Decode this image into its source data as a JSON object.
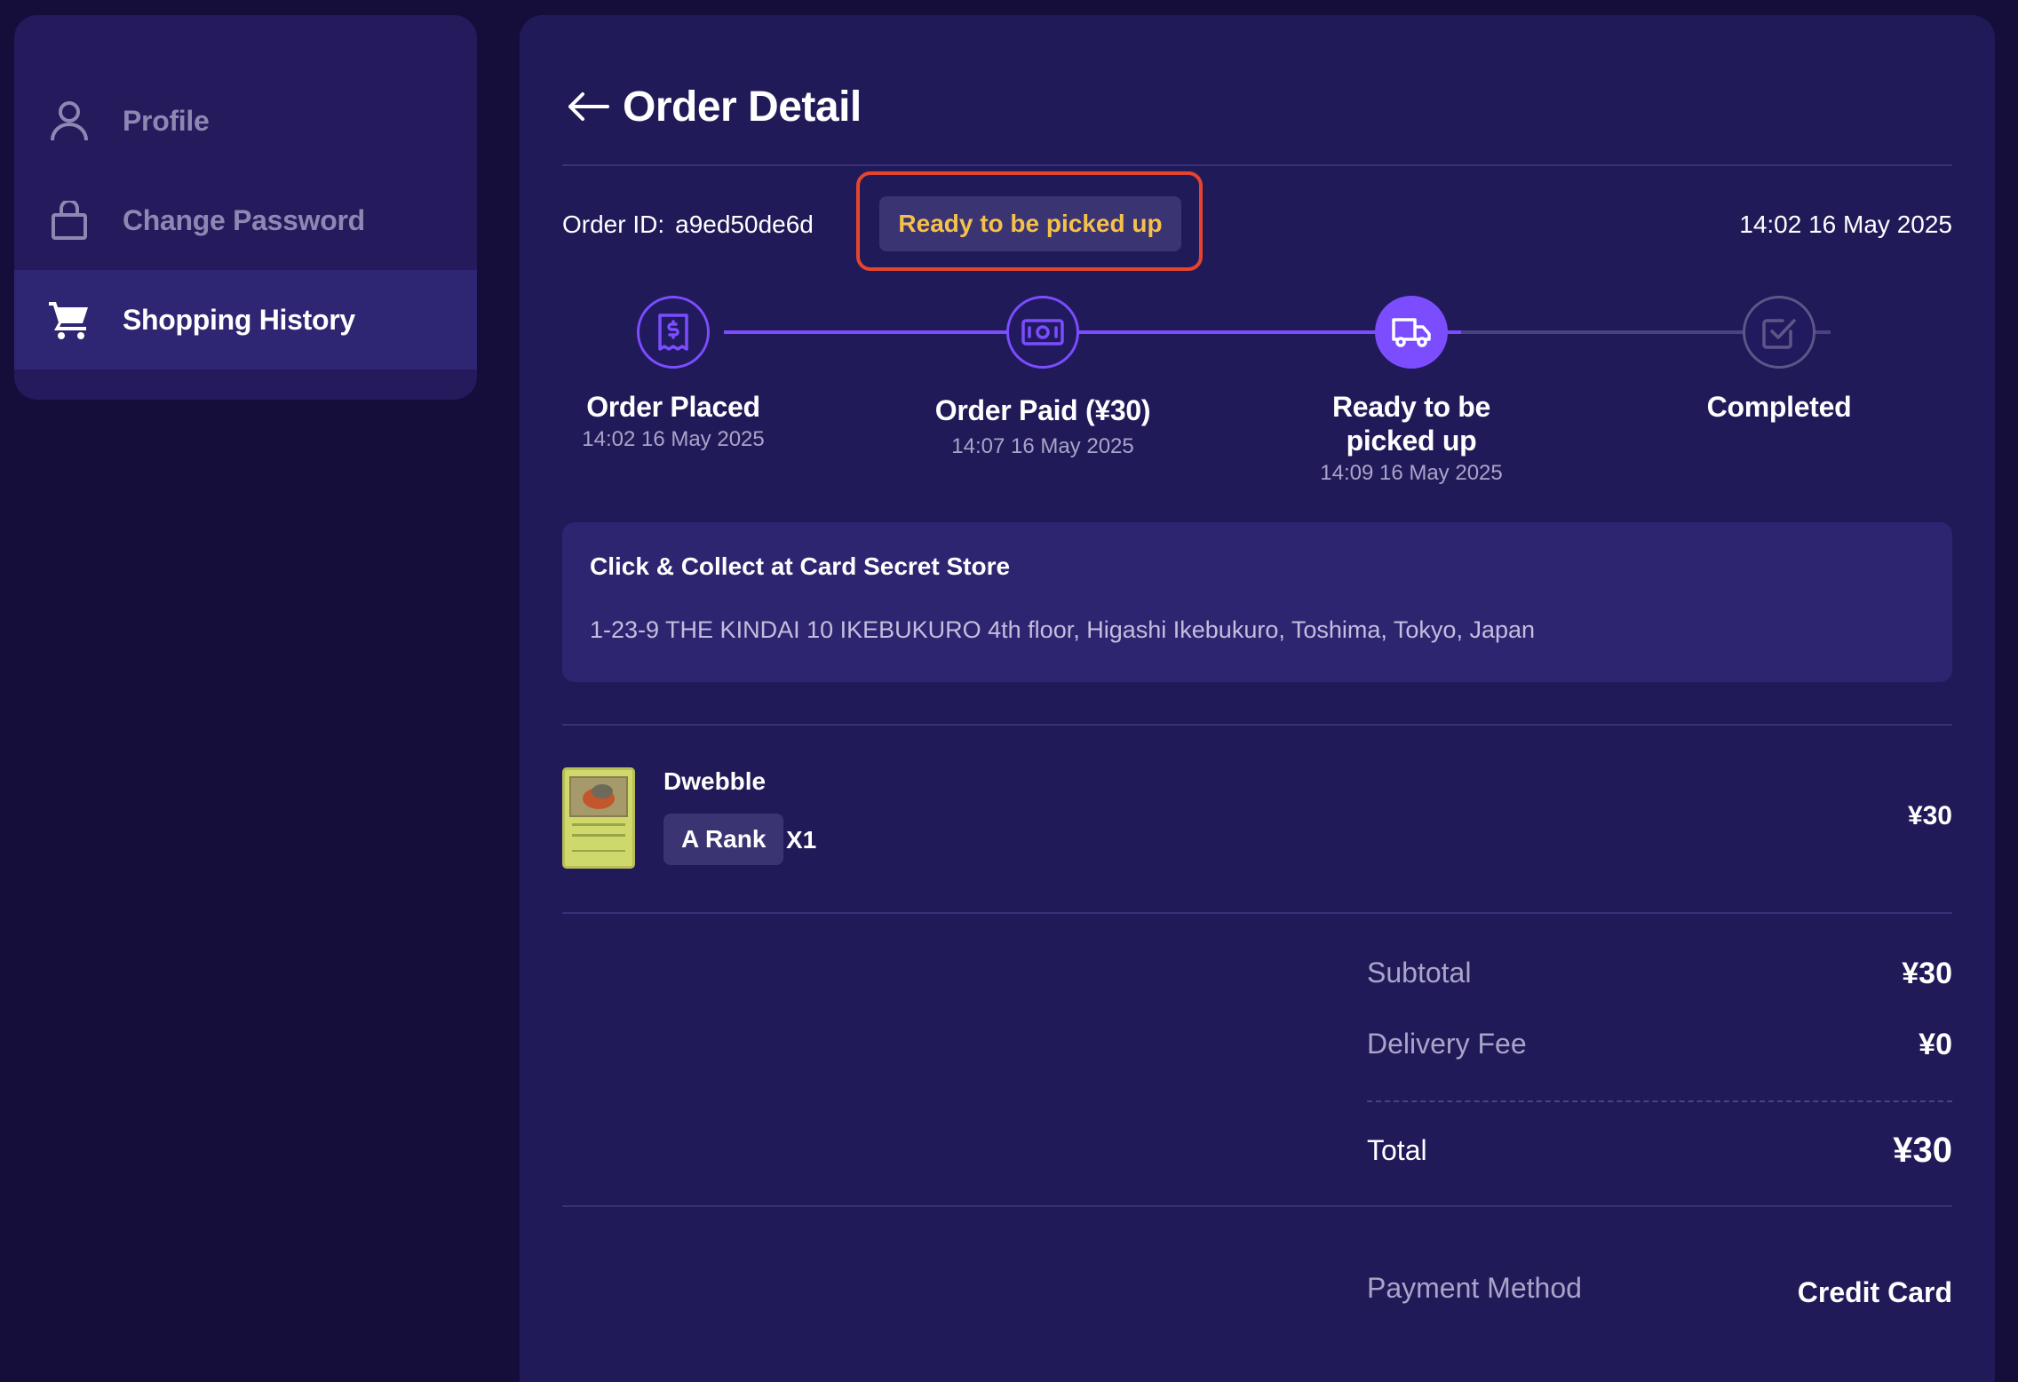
{
  "sidebar": {
    "items": [
      {
        "label": "Profile",
        "icon": "user-icon",
        "active": false
      },
      {
        "label": "Change Password",
        "icon": "lock-icon",
        "active": false
      },
      {
        "label": "Shopping History",
        "icon": "cart-icon",
        "active": true
      }
    ]
  },
  "header": {
    "title": "Order Detail",
    "back_icon": "arrow-left-icon"
  },
  "order": {
    "id_label": "Order ID:",
    "id_value": "a9ed50de6d",
    "status": "Ready to be picked up",
    "time": "14:02 16 May 2025"
  },
  "steps": [
    {
      "title": "Order Placed",
      "time": "14:02 16 May 2025",
      "icon": "receipt-icon",
      "state": "done"
    },
    {
      "title": "Order Paid (¥30)",
      "time": "14:07 16 May 2025",
      "icon": "cash-icon",
      "state": "done"
    },
    {
      "title": "Ready to be picked up",
      "time": "14:09 16 May 2025",
      "icon": "truck-icon",
      "state": "current"
    },
    {
      "title": "Completed",
      "time": "",
      "icon": "check-square-icon",
      "state": "pending"
    }
  ],
  "store": {
    "title": "Click & Collect at Card Secret Store",
    "address": "1-23-9 THE KINDAI 10 IKEBUKURO 4th floor, Higashi Ikebukuro, Toshima, Tokyo, Japan"
  },
  "item": {
    "name": "Dwebble",
    "rank": "A Rank",
    "qty": "X1",
    "price": "¥30"
  },
  "summary": {
    "subtotal_label": "Subtotal",
    "subtotal": "¥30",
    "delivery_label": "Delivery Fee",
    "delivery": "¥0",
    "total_label": "Total",
    "total": "¥30",
    "payment_label": "Payment Method",
    "payment": "Credit Card"
  },
  "colors": {
    "accent": "#7b4dff",
    "status": "#f5c14a",
    "highlight": "#e5452f"
  }
}
